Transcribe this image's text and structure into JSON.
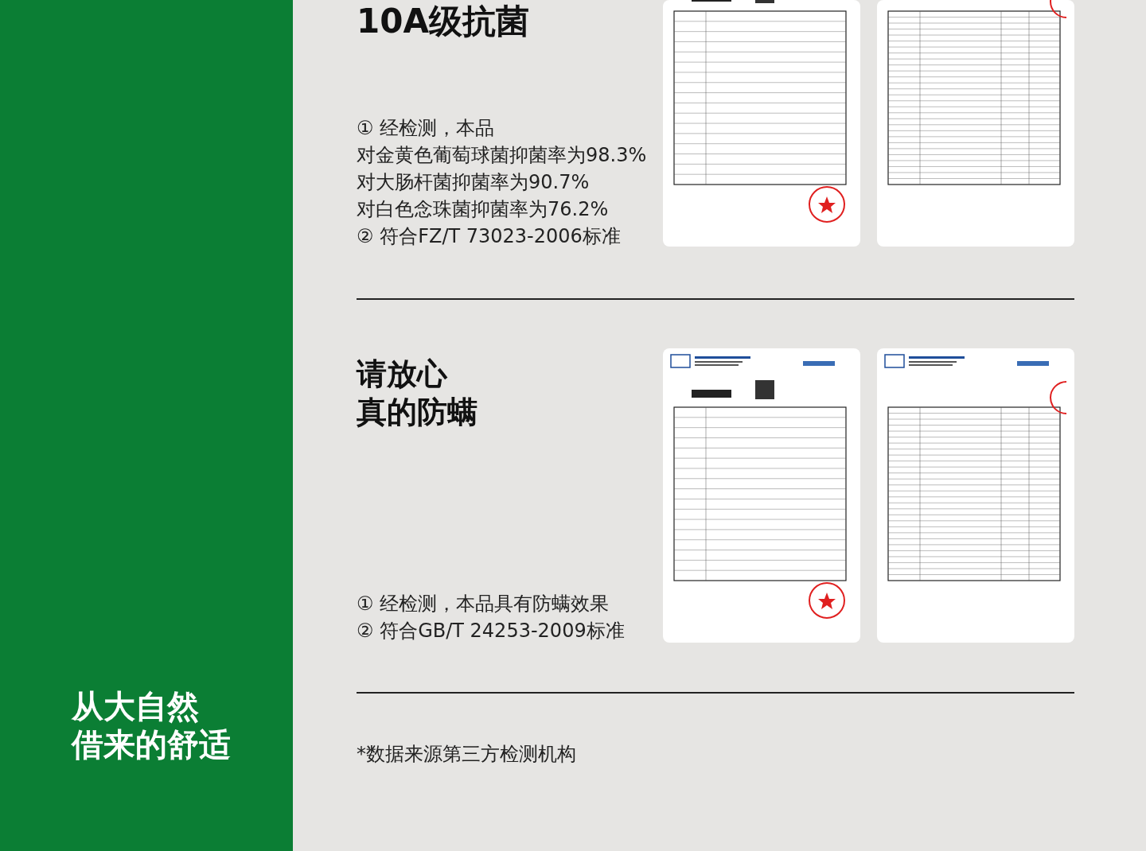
{
  "sidebar": {
    "slogan_lines": [
      "从大自然",
      "借来的舒适"
    ]
  },
  "sections": [
    {
      "title_lines": [
        "10A级抗菌"
      ],
      "points": [
        "① 经检测，本品",
        "对金黄色葡萄球菌抑菌率为98.3%",
        "对大肠杆菌抑菌率为90.7%",
        "对白色念珠菌抑菌率为76.2%",
        "② 符合FZ/T 73023-2006标准"
      ],
      "reports": [
        {
          "kind": "cover"
        },
        {
          "kind": "table"
        }
      ]
    },
    {
      "title_lines": [
        "请放心",
        "真的防螨"
      ],
      "points": [
        "① 经检测，本品具有防螨效果",
        "② 符合GB/T 24253-2009标准"
      ],
      "reports": [
        {
          "kind": "cover"
        },
        {
          "kind": "table"
        }
      ]
    }
  ],
  "footnote": "*数据来源第三方检测机构"
}
